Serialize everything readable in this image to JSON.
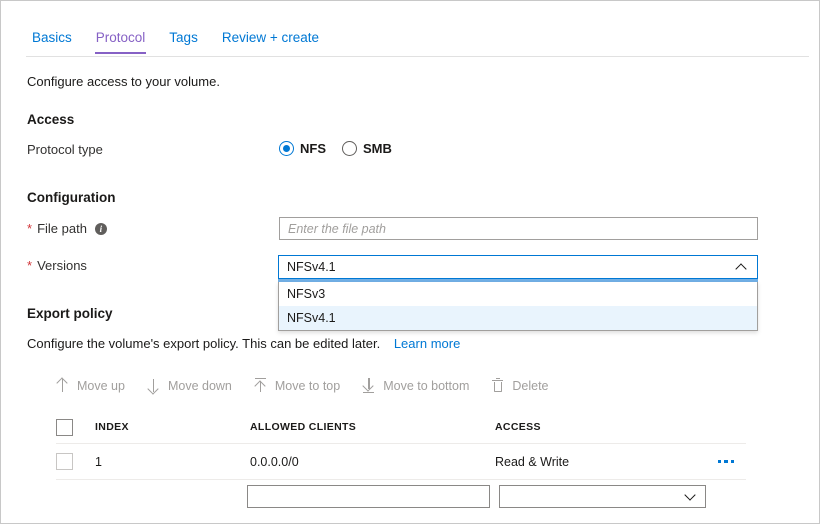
{
  "tabs": [
    {
      "label": "Basics",
      "active": false
    },
    {
      "label": "Protocol",
      "active": true
    },
    {
      "label": "Tags",
      "active": false
    },
    {
      "label": "Review + create",
      "active": false
    }
  ],
  "intro": "Configure access to your volume.",
  "access": {
    "heading": "Access",
    "protocol_label": "Protocol type",
    "options": [
      {
        "label": "NFS",
        "checked": true
      },
      {
        "label": "SMB",
        "checked": false
      }
    ]
  },
  "configuration": {
    "heading": "Configuration",
    "file_path": {
      "label": "File path",
      "required_mark": "*",
      "info_glyph": "i",
      "value": "",
      "placeholder": "Enter the file path"
    },
    "versions": {
      "label": "Versions",
      "required_mark": "*",
      "selected": "NFSv4.1",
      "expanded": true,
      "chevron": "chevron-up",
      "options": [
        {
          "label": "NFSv3",
          "selected": false
        },
        {
          "label": "NFSv4.1",
          "selected": true
        }
      ]
    }
  },
  "export_policy": {
    "heading": "Export policy",
    "description": "Configure the volume's export policy. This can be edited later.",
    "learn_more": "Learn more",
    "commands": [
      {
        "label": "Move up",
        "icon": "arrow-up-icon",
        "disabled": true
      },
      {
        "label": "Move down",
        "icon": "arrow-down-icon",
        "disabled": true
      },
      {
        "label": "Move to top",
        "icon": "arrow-to-top-icon",
        "disabled": true
      },
      {
        "label": "Move to bottom",
        "icon": "arrow-to-bottom-icon",
        "disabled": true
      },
      {
        "label": "Delete",
        "icon": "trash-icon",
        "disabled": true
      }
    ],
    "table": {
      "columns": [
        "INDEX",
        "ALLOWED CLIENTS",
        "ACCESS"
      ],
      "rows": [
        {
          "index": "1",
          "allowed_clients": "0.0.0.0/0",
          "access": "Read & Write"
        }
      ]
    },
    "editor": {
      "client_value": "",
      "client_placeholder": "",
      "access_value": "",
      "chevron": "chevron-down"
    }
  },
  "colors": {
    "link": "#0078d4",
    "active_tab": "#8661c5",
    "required": "#d13438",
    "highlight": "#e9f4fd",
    "focus_border": "#0078d4"
  }
}
